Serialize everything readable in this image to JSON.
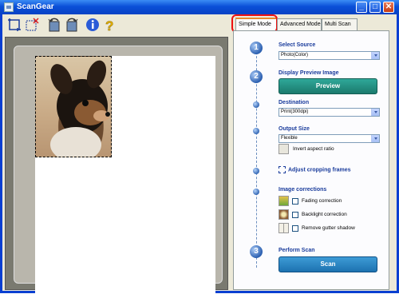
{
  "window": {
    "title": "ScanGear"
  },
  "titlebar_buttons": {
    "minimize": "_",
    "maximize": "□",
    "close": "✕"
  },
  "toolbar": {
    "icons": [
      "crop-icon",
      "clear-crop-icon",
      "rotate-left-icon",
      "rotate-right-icon",
      "info-icon",
      "help-icon"
    ]
  },
  "tabs": [
    {
      "label": "Simple Mode",
      "active": true
    },
    {
      "label": "Advanced Mode",
      "active": false
    },
    {
      "label": "Multi Scan",
      "active": false
    }
  ],
  "steps": {
    "step1_number": "1",
    "step2_number": "2",
    "step3_number": "3"
  },
  "select_source": {
    "heading": "Select Source",
    "value": "Photo(Color)"
  },
  "display_preview": {
    "heading": "Display Preview Image",
    "button": "Preview"
  },
  "destination": {
    "heading": "Destination",
    "value": "Print(300dpi)"
  },
  "output_size": {
    "heading": "Output Size",
    "value": "Flexible",
    "invert_label": "Invert aspect ratio"
  },
  "adjust_cropping": {
    "label": "Adjust cropping frames"
  },
  "image_corrections": {
    "heading": "Image corrections",
    "options": [
      {
        "label": "Fading correction",
        "checked": false
      },
      {
        "label": "Backlight correction",
        "checked": false
      },
      {
        "label": "Remove gutter shadow",
        "checked": false
      }
    ]
  },
  "perform_scan": {
    "heading": "Perform Scan",
    "button": "Scan"
  },
  "colors": {
    "titlebar": "#0a4fd8",
    "heading": "#1a3c9c",
    "preview_button": "#1b7a6d",
    "scan_button": "#1d72b0",
    "tab_highlight": "#e11111"
  }
}
